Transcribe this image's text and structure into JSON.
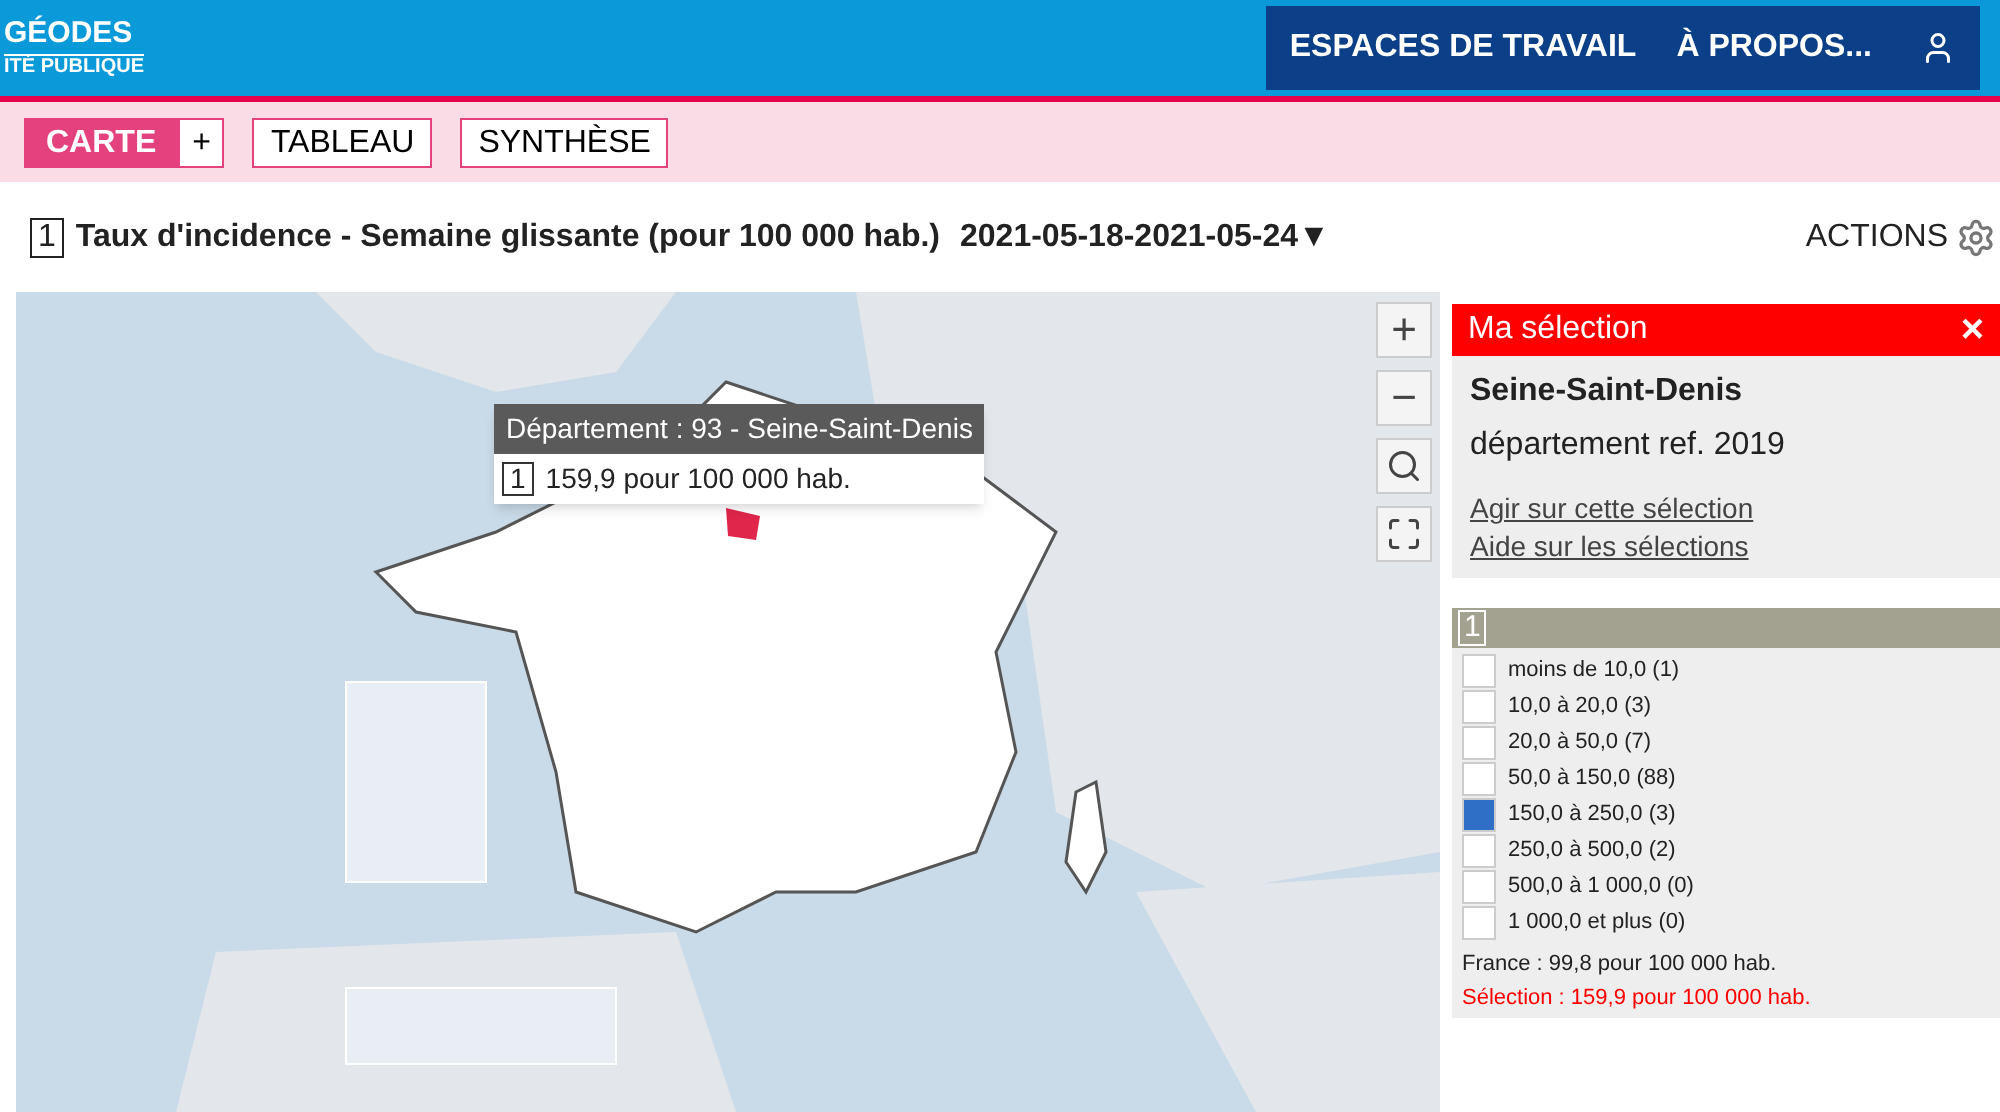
{
  "header": {
    "logo_title": "GÉODES",
    "logo_subtitle": "ITÉ PUBLIQUE",
    "nav": [
      "ESPACES DE TRAVAIL",
      "À PROPOS..."
    ]
  },
  "tabs": [
    {
      "label": "CARTE",
      "selected": true
    },
    {
      "label": "TABLEAU",
      "selected": false
    },
    {
      "label": "SYNTHÈSE",
      "selected": false
    }
  ],
  "add_tab": "+",
  "indicator": {
    "number": "1",
    "title": "Taux d'incidence - Semaine glissante (pour 100 000 hab.)",
    "period": "2021-05-18-2021-05-24",
    "caret": "▼",
    "actions": "ACTIONS"
  },
  "map": {
    "kind": "picture",
    "controls": [
      "+",
      "−"
    ],
    "tooltip": {
      "title": "Département : 93 - Seine-Saint-Denis",
      "number": "1",
      "value": "159,9 pour 100 000 hab."
    }
  },
  "selection": {
    "title": "Ma sélection",
    "close": "×",
    "name": "Seine-Saint-Denis",
    "ref": "département ref. 2019",
    "links": [
      "Agir sur cette sélection",
      "Aide sur les sélections"
    ]
  },
  "legend": {
    "number": "1",
    "items": [
      {
        "label": "moins de 10,0 (1)",
        "color": "#ffffff"
      },
      {
        "label": "10,0 à 20,0 (3)",
        "color": "#ffffff"
      },
      {
        "label": "20,0 à 50,0 (7)",
        "color": "#ffffff"
      },
      {
        "label": "50,0 à 150,0 (88)",
        "color": "#ffffff"
      },
      {
        "label": "150,0 à 250,0 (3)",
        "color": "#2f6fc6"
      },
      {
        "label": "250,0 à 500,0 (2)",
        "color": "#ffffff"
      },
      {
        "label": "500,0 à 1 000,0 (0)",
        "color": "#ffffff"
      },
      {
        "label": "1 000,0 et plus (0)",
        "color": "#ffffff"
      }
    ],
    "france": "France : 99,8 pour 100 000 hab.",
    "selection": "Sélection : 159,9 pour 100 000 hab."
  }
}
